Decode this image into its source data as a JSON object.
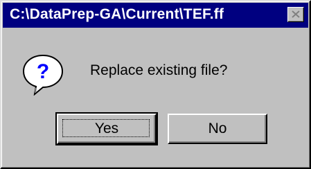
{
  "window": {
    "title": "C:\\DataPrep-GA\\Current\\TEF.ff"
  },
  "message": "Replace existing file?",
  "icon": "question-icon",
  "buttons": {
    "yes": "Yes",
    "no": "No"
  },
  "colors": {
    "titlebar": "#000080",
    "face": "#c0c0c0"
  }
}
